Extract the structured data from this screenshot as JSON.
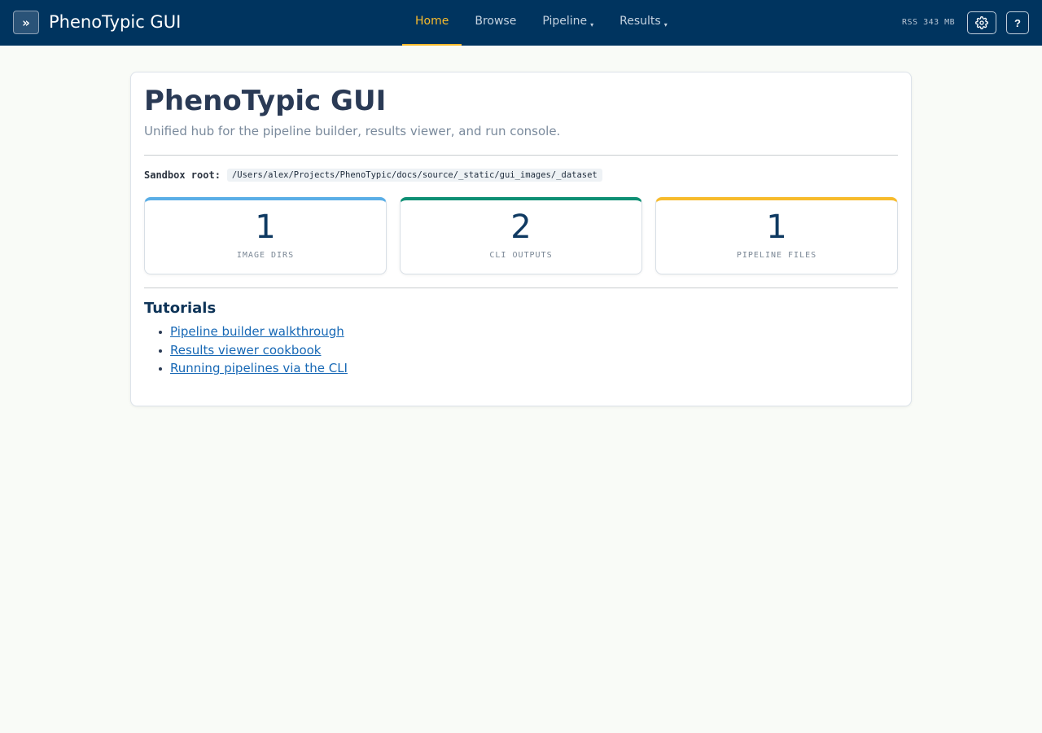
{
  "navbar": {
    "toggle_label": "»",
    "brand": "PhenoTypic GUI",
    "links": [
      {
        "label": "Home",
        "active": true,
        "dropdown": false
      },
      {
        "label": "Browse",
        "active": false,
        "dropdown": false
      },
      {
        "label": "Pipeline",
        "active": false,
        "dropdown": true
      },
      {
        "label": "Results",
        "active": false,
        "dropdown": true
      }
    ],
    "caret": "▾",
    "rss": "RSS 343 MB",
    "settings_icon": "gear-icon",
    "help_label": "?"
  },
  "main": {
    "title": "PhenoTypic GUI",
    "subtitle": "Unified hub for the pipeline builder, results viewer, and run console.",
    "sandbox_label": "Sandbox root:",
    "sandbox_path": "/Users/alex/Projects/PhenoTypic/docs/source/_static/gui_images/_dataset",
    "stats": [
      {
        "value": "1",
        "label": "IMAGE DIRS",
        "color": "#5aaee6"
      },
      {
        "value": "2",
        "label": "CLI OUTPUTS",
        "color": "#0e8f74"
      },
      {
        "value": "1",
        "label": "PIPELINE FILES",
        "color": "#f7bb2c"
      }
    ],
    "tutorials_title": "Tutorials",
    "tutorials": [
      "Pipeline builder walkthrough",
      "Results viewer cookbook",
      "Running pipelines via the CLI"
    ]
  },
  "colors": {
    "navbar": "#00345f",
    "accent": "#f7bb2c",
    "link": "#1768b5",
    "background": "#f9fbf7"
  }
}
